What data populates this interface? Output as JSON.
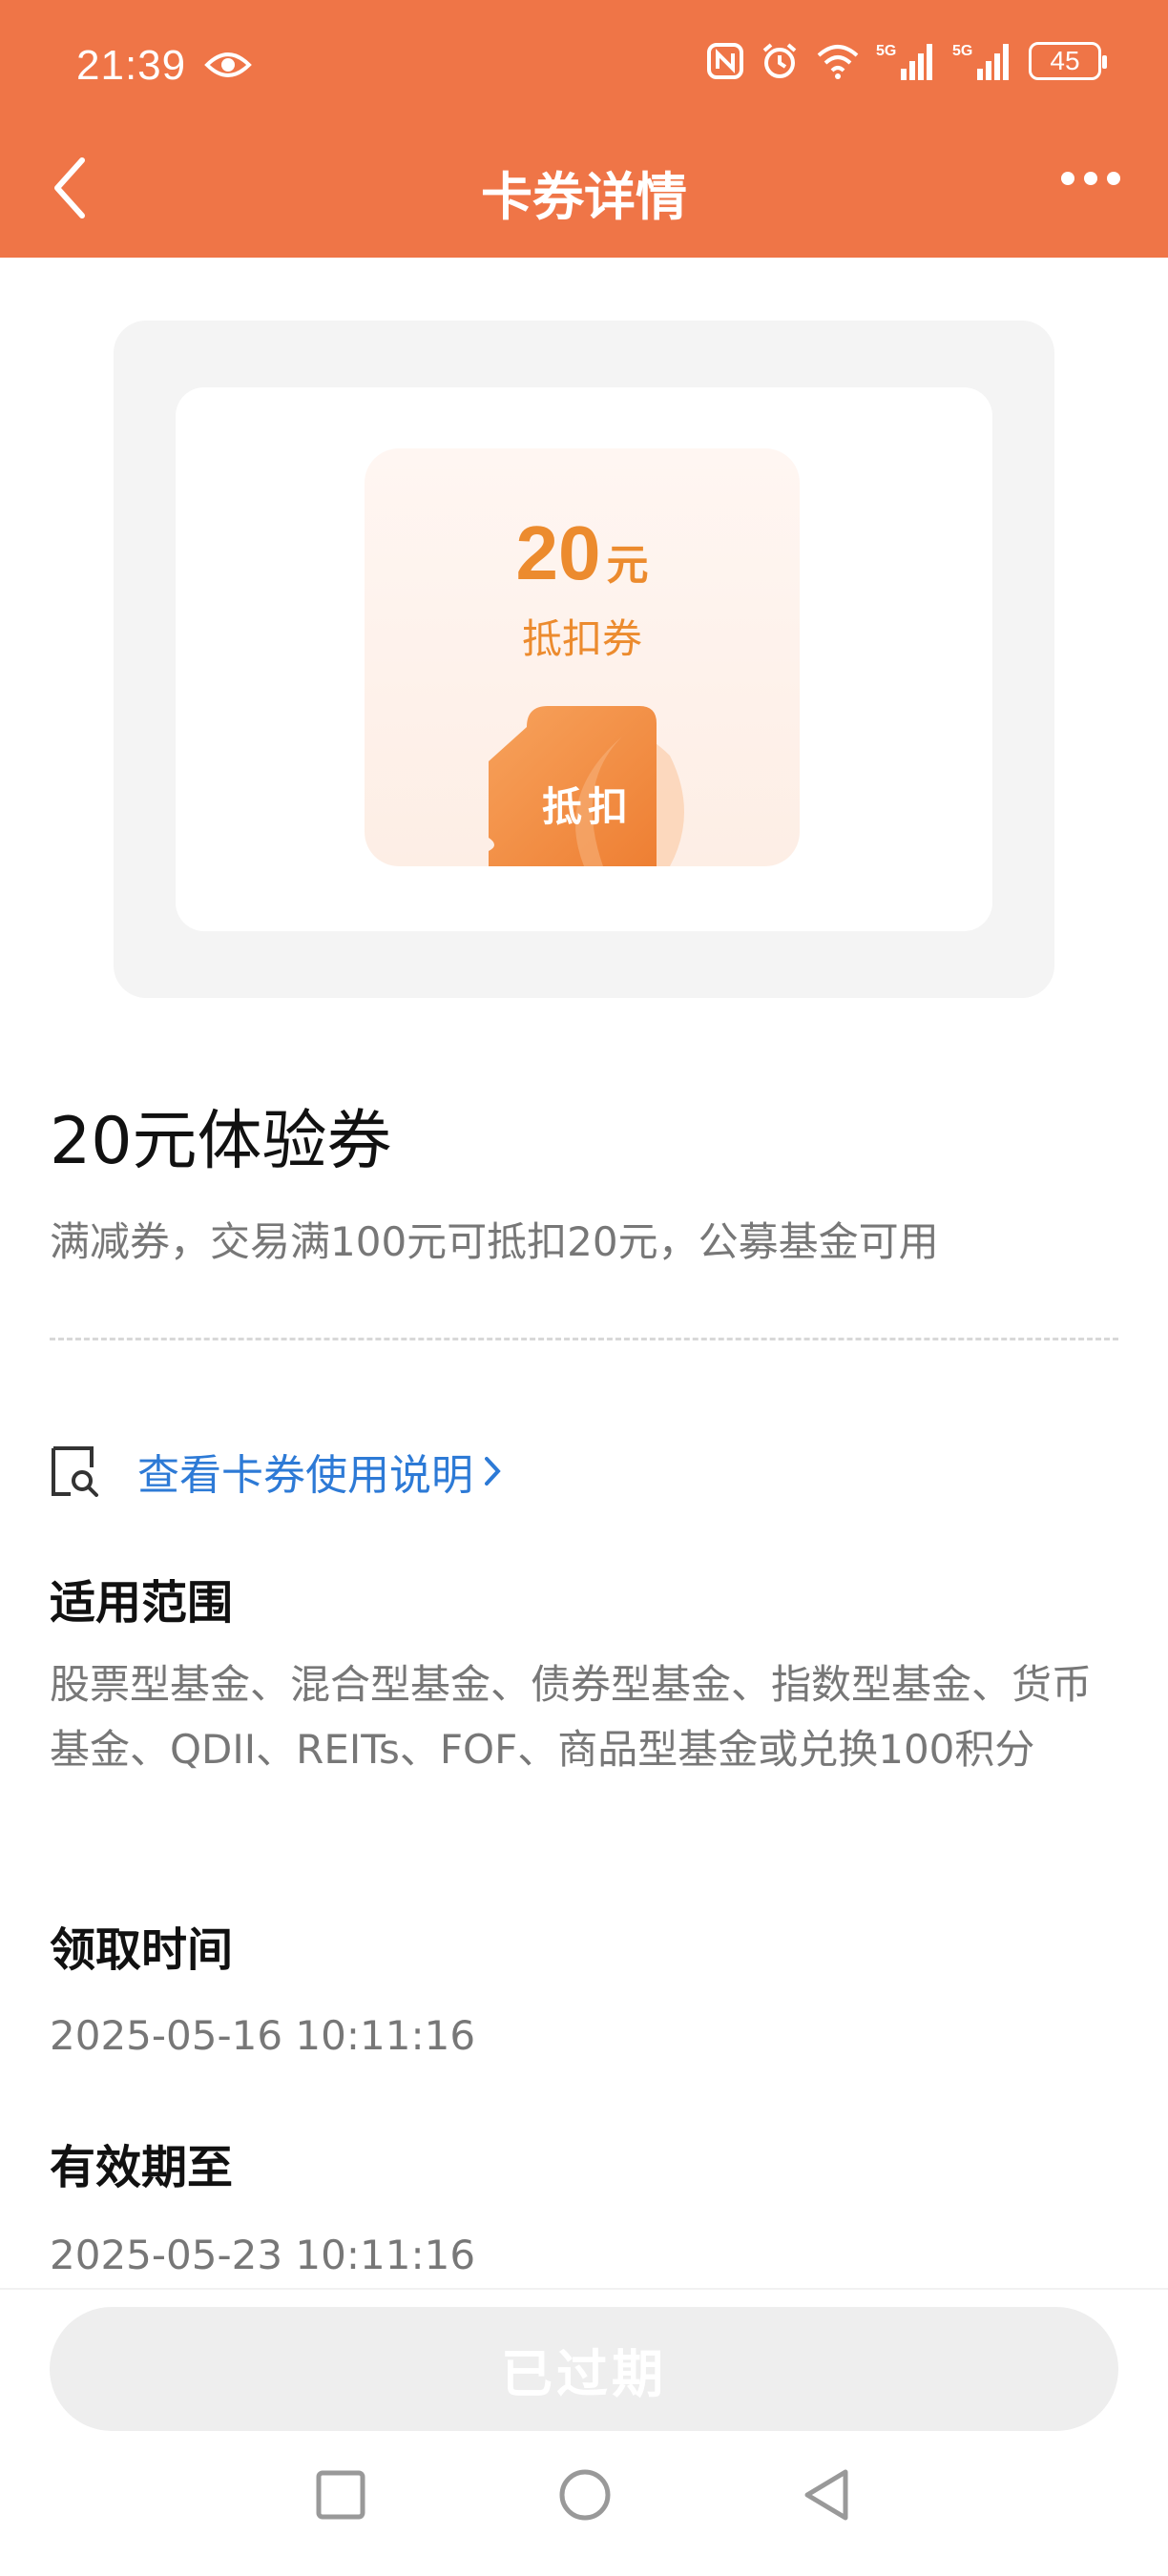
{
  "status_bar": {
    "time": "21:39",
    "battery": "45",
    "icons": [
      "eye-icon",
      "nfc-icon",
      "alarm-icon",
      "wifi-icon",
      "5g-signal-icon",
      "5g-signal-icon",
      "battery-icon"
    ]
  },
  "header": {
    "title": "卡券详情",
    "back_icon": "chevron-left-icon",
    "more_icon": "more-dots-icon"
  },
  "coupon_visual": {
    "amount": "20",
    "unit": "元",
    "type": "抵扣券",
    "ticket_label": "抵扣"
  },
  "coupon": {
    "name": "20元体验券",
    "description": "满减券，交易满100元可抵扣20元，公募基金可用",
    "usage_link": "查看卡券使用说明"
  },
  "sections": {
    "scope_title": "适用范围",
    "scope_value": "股票型基金、混合型基金、债券型基金、指数型基金、货币基金、QDII、REITs、FOF、商品型基金或兑换100积分",
    "received_title": "领取时间",
    "received_value": "2025-05-16 10:11:16",
    "expiry_title": "有效期至",
    "expiry_value": "2025-05-23 10:11:16"
  },
  "footer": {
    "button_label": "已过期"
  },
  "colors": {
    "brand": "#ef7547",
    "coupon_accent": "#ec8b2e",
    "link": "#2d7ad6"
  }
}
